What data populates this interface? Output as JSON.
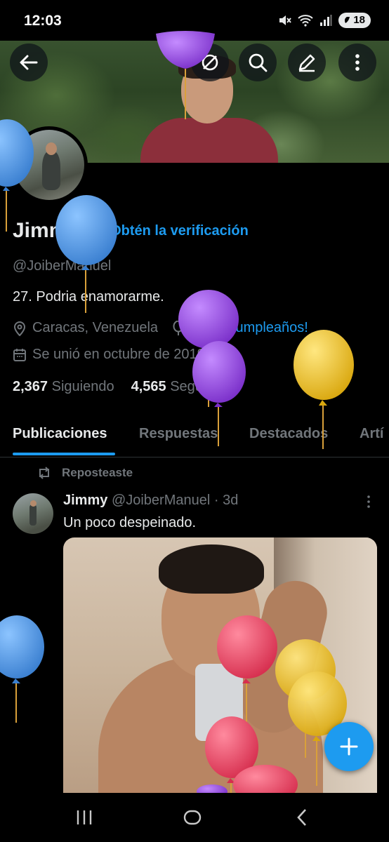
{
  "status_bar": {
    "time": "12:03",
    "battery_level": "18"
  },
  "profile": {
    "name": "Jimmy",
    "verify_cta": "Obtén la verificación",
    "handle": "@JoiberManuel",
    "bio": "27. Podria enamorarme.",
    "location": "Caracas, Venezuela",
    "birthday": "¡Feliz cumpleaños!",
    "joined": "Se unió en octubre de 2019",
    "following_count": "2,367",
    "following_label": "Siguiendo",
    "followers_count": "4,565",
    "followers_label": "Seguidores"
  },
  "tabs": [
    "Publicaciones",
    "Respuestas",
    "Destacados",
    "Artí"
  ],
  "post": {
    "repost_label": "Reposteaste",
    "author": "Jimmy",
    "meta": "@JoiberManuel · 3d",
    "text": "Un poco despeinado."
  },
  "colors": {
    "accent": "#1d9bf0",
    "background": "#000000",
    "muted_text": "#71767b",
    "balloon_blue": "#4a90e2",
    "balloon_purple": "#8e44d9",
    "balloon_yellow": "#f0c419",
    "balloon_pink": "#e8415f"
  }
}
